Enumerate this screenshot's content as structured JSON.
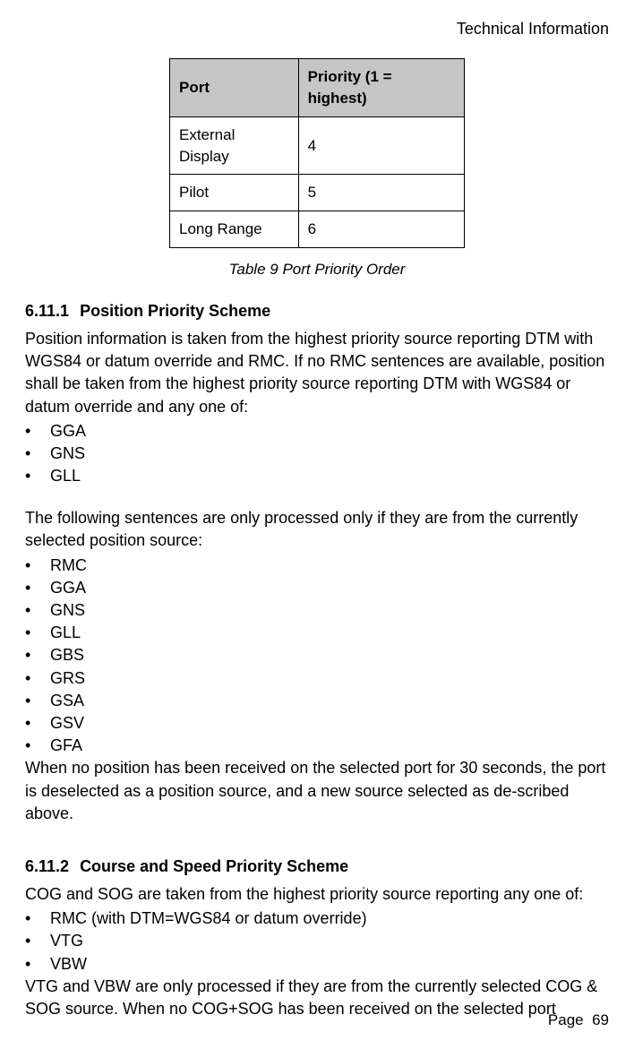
{
  "header": {
    "title": "Technical Information"
  },
  "chart_data": {
    "type": "table",
    "headers": [
      "Port",
      "Priority (1 = highest)"
    ],
    "rows": [
      [
        "External Display",
        "4"
      ],
      [
        "Pilot",
        "5"
      ],
      [
        "Long Range",
        "6"
      ]
    ],
    "caption": "Table 9  Port Priority Order"
  },
  "sections": {
    "s1": {
      "number": "6.11.1",
      "title": "Position Priority Scheme",
      "para1": "Position information is taken from the highest priority source reporting DTM with WGS84 or datum override and RMC. If no RMC sentences are available, position shall be taken from the highest priority source reporting DTM with WGS84 or datum override and any one of:",
      "list1": [
        "GGA",
        "GNS",
        "GLL"
      ],
      "para2": "The following sentences are only processed only if they are from the currently selected position source:",
      "list2": [
        "RMC",
        "GGA",
        "GNS",
        "GLL",
        "GBS",
        "GRS",
        "GSA",
        "GSV",
        "GFA"
      ],
      "para3": "When no position has been received on the selected port for 30 seconds, the port is deselected as a position source, and a new source selected as de-scribed above."
    },
    "s2": {
      "number": "6.11.2",
      "title": "Course and Speed Priority Scheme",
      "para1": "COG and SOG are taken from the highest priority source reporting any one of:",
      "list1": [
        "RMC (with DTM=WGS84 or datum override)",
        "VTG",
        "VBW"
      ],
      "para2": "VTG and VBW are only processed if they are from the currently selected COG & SOG source. When no COG+SOG has been received on the selected port"
    }
  },
  "footer": {
    "page_label": "Page",
    "page_number": "69"
  }
}
